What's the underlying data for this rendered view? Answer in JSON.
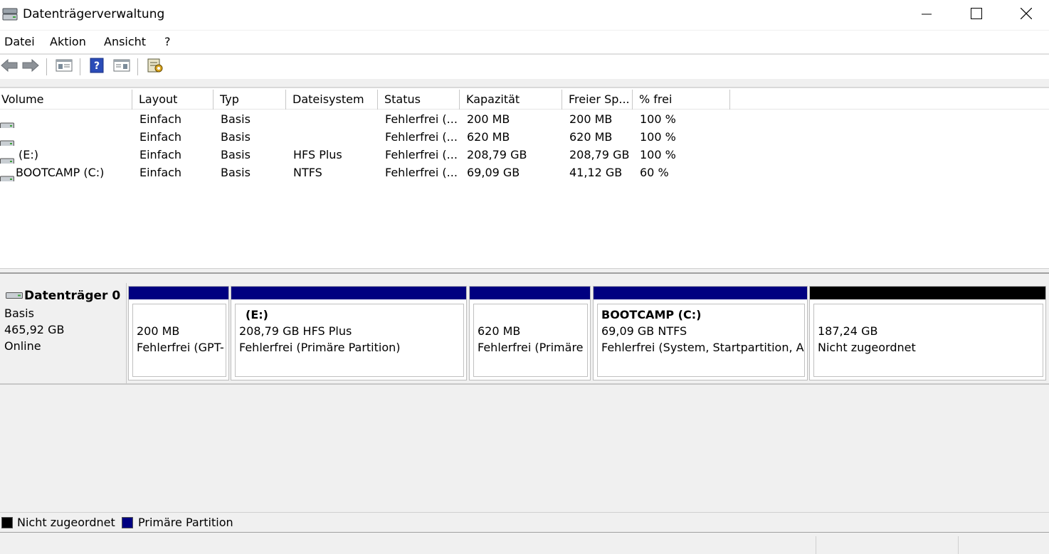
{
  "window": {
    "title": "Datenträgerverwaltung",
    "minimize_icon": "minimize-icon",
    "maximize_icon": "maximize-icon",
    "close_icon": "close-icon"
  },
  "menu": {
    "items": [
      "Datei",
      "Aktion",
      "Ansicht",
      "?"
    ]
  },
  "toolbar": {
    "buttons": [
      "back-arrow-icon",
      "forward-arrow-icon",
      "console-tree-icon",
      "help-icon",
      "action-pane-icon",
      "properties-icon"
    ]
  },
  "volume_list": {
    "columns": [
      "Volume",
      "Layout",
      "Typ",
      "Dateisystem",
      "Status",
      "Kapazität",
      "Freier Sp...",
      "% frei"
    ],
    "rows": [
      [
        "",
        "Einfach",
        "Basis",
        "",
        "Fehlerfrei (...",
        "200 MB",
        "200 MB",
        "100 %"
      ],
      [
        "",
        "Einfach",
        "Basis",
        "",
        "Fehlerfrei (...",
        "620 MB",
        "620 MB",
        "100 %"
      ],
      [
        "(E:)",
        "Einfach",
        "Basis",
        "HFS Plus",
        "Fehlerfrei (...",
        "208,79 GB",
        "208,79 GB",
        "100 %"
      ],
      [
        "BOOTCAMP (C:)",
        "Einfach",
        "Basis",
        "NTFS",
        "Fehlerfrei (...",
        "69,09 GB",
        "41,12 GB",
        "60 %"
      ]
    ]
  },
  "disk": {
    "name": "Datenträger 0",
    "type": "Basis",
    "size": "465,92 GB",
    "state": "Online",
    "partitions": [
      {
        "name": "",
        "size": "200 MB",
        "status": "Fehlerfrei (GPT-",
        "bar_color": "#000080"
      },
      {
        "name": "(E:)",
        "size": "208,79 GB HFS Plus",
        "status": "Fehlerfrei (Primäre Partition)",
        "bar_color": "#000080"
      },
      {
        "name": "",
        "size": "620 MB",
        "status": "Fehlerfrei (Primäre",
        "bar_color": "#000080"
      },
      {
        "name": "BOOTCAMP  (C:)",
        "size": "69,09 GB NTFS",
        "status": "Fehlerfrei (System, Startpartition, Au",
        "bar_color": "#000080"
      },
      {
        "name": "",
        "size": "187,24 GB",
        "status": "Nicht zugeordnet",
        "bar_color": "#000000"
      }
    ]
  },
  "legend": {
    "unallocated": {
      "label": "Nicht zugeordnet",
      "color": "#000000"
    },
    "primary": {
      "label": "Primäre Partition",
      "color": "#000080"
    }
  }
}
